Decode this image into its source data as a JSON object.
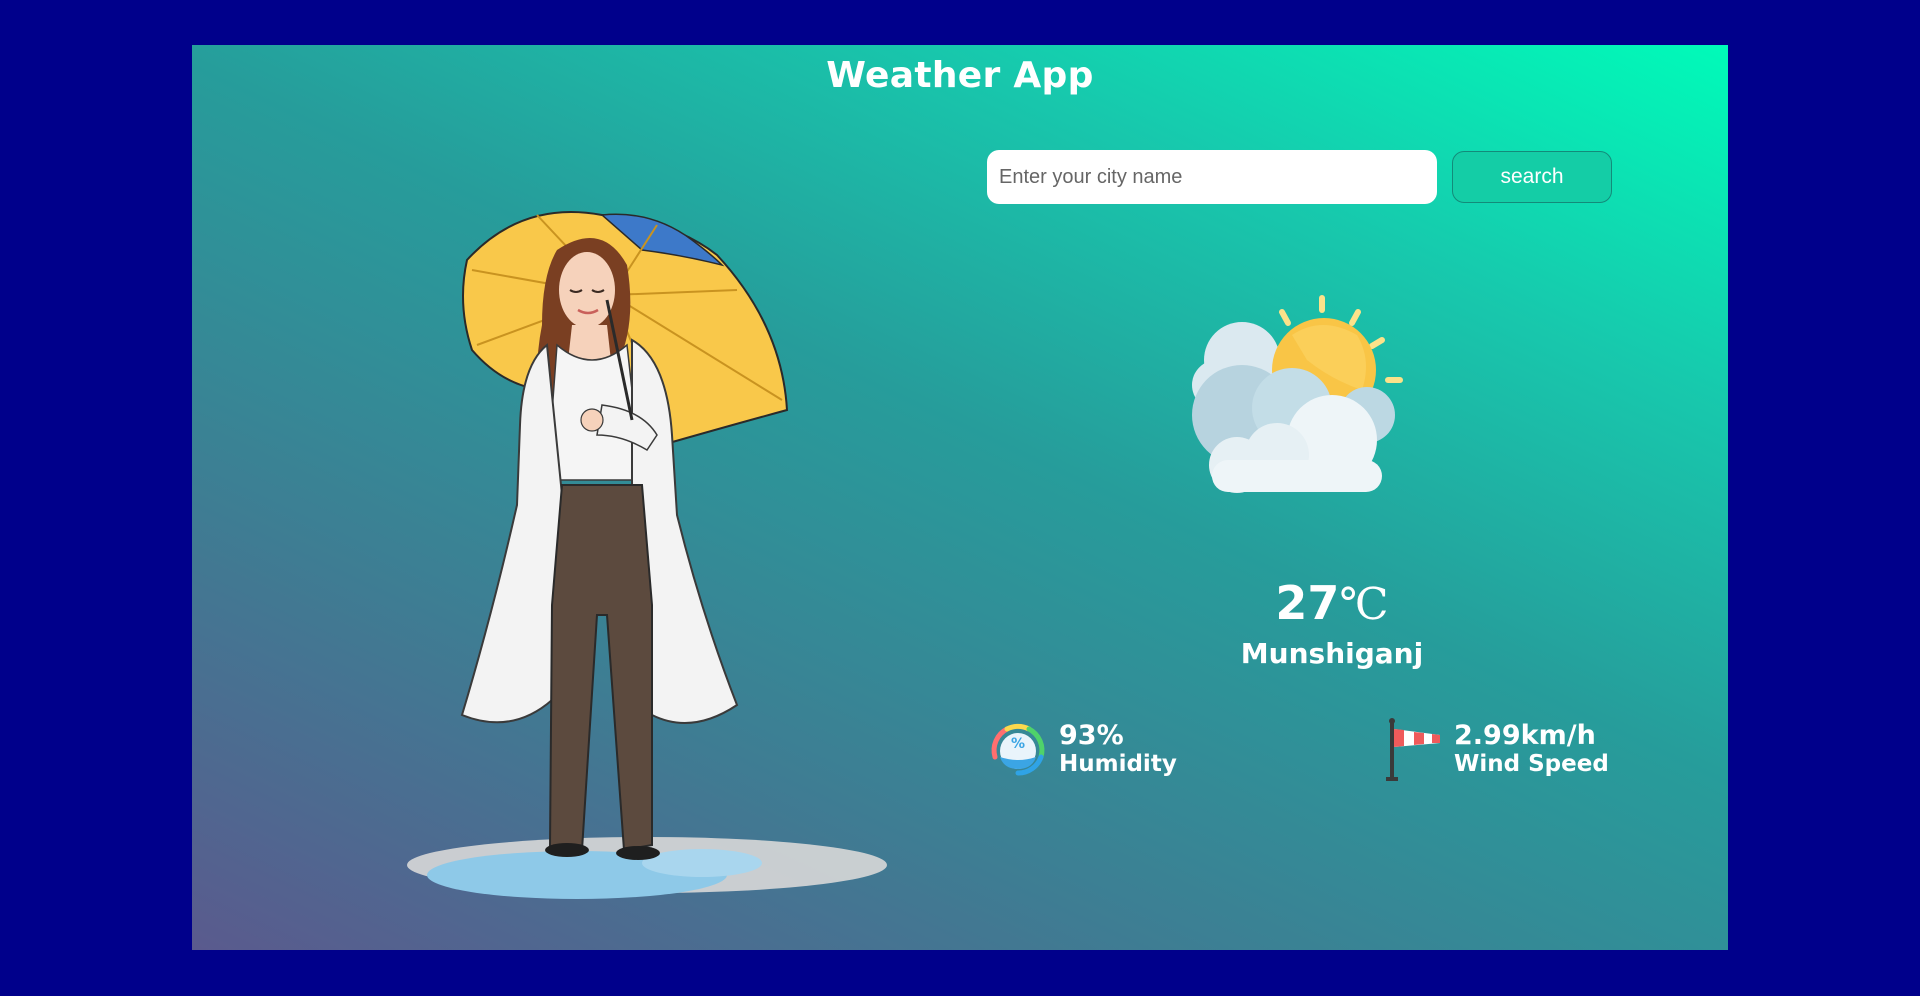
{
  "app": {
    "title": "Weather App"
  },
  "search": {
    "placeholder": "Enter your city name",
    "value": "",
    "button_label": "search"
  },
  "weather": {
    "condition_icon": "partly-cloudy-icon",
    "temperature_value": "27",
    "temperature_unit": "℃",
    "city": "Munshiganj"
  },
  "details": {
    "humidity": {
      "value": "93%",
      "label": "Humidity",
      "icon": "humidity-icon"
    },
    "wind": {
      "value": "2.99km/h",
      "label": "Wind Speed",
      "icon": "windsock-icon"
    }
  },
  "colors": {
    "page_background": "#00008b",
    "gradient_top": "#00fbb9",
    "gradient_bottom": "#5a5a8e",
    "button_background": "#14cda6",
    "text": "#ffffff"
  }
}
